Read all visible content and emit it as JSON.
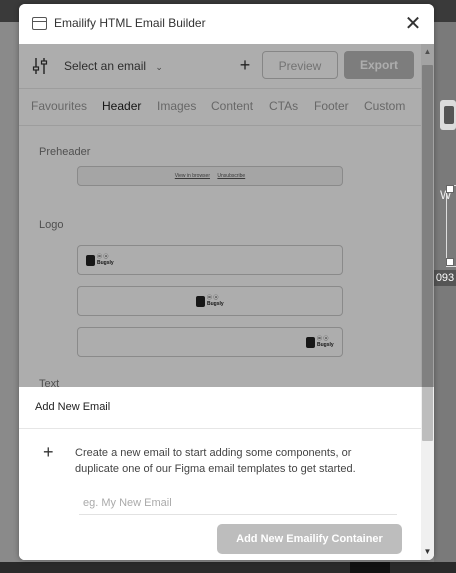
{
  "window": {
    "title": "Emailify HTML Email Builder",
    "close_glyph": "✕",
    "app_icon": "window-icon"
  },
  "toolbar": {
    "select_email": "Select an email",
    "add_glyph": "+",
    "preview_label": "Preview",
    "export_label": "Export"
  },
  "tabs": [
    {
      "label": "Favourites"
    },
    {
      "label": "Header",
      "active": true
    },
    {
      "label": "Images"
    },
    {
      "label": "Content"
    },
    {
      "label": "CTAs"
    },
    {
      "label": "Footer"
    },
    {
      "label": "Custom"
    }
  ],
  "content": {
    "preheader_label": "Preheader",
    "preheader_view_link": "View in browser",
    "preheader_unsub_link": "Unsubscribe",
    "logo_label": "Logo",
    "text_label": "Text",
    "logo_line1": "ⓦ ⓤ",
    "logo_line2": "Bugsly"
  },
  "dialog": {
    "title": "Add New Email",
    "plus_glyph": "+",
    "description": "Create a new email to start adding some components, or duplicate one of our Figma email templates to get started.",
    "input_placeholder": "eg. My New Email",
    "input_value": "",
    "button_label": "Add New Emailify Container"
  },
  "background": {
    "right_readout": "093"
  },
  "colors": {
    "button_disabled": "#bdbdbd",
    "overlay": "rgba(0,0,0,0.32)"
  }
}
